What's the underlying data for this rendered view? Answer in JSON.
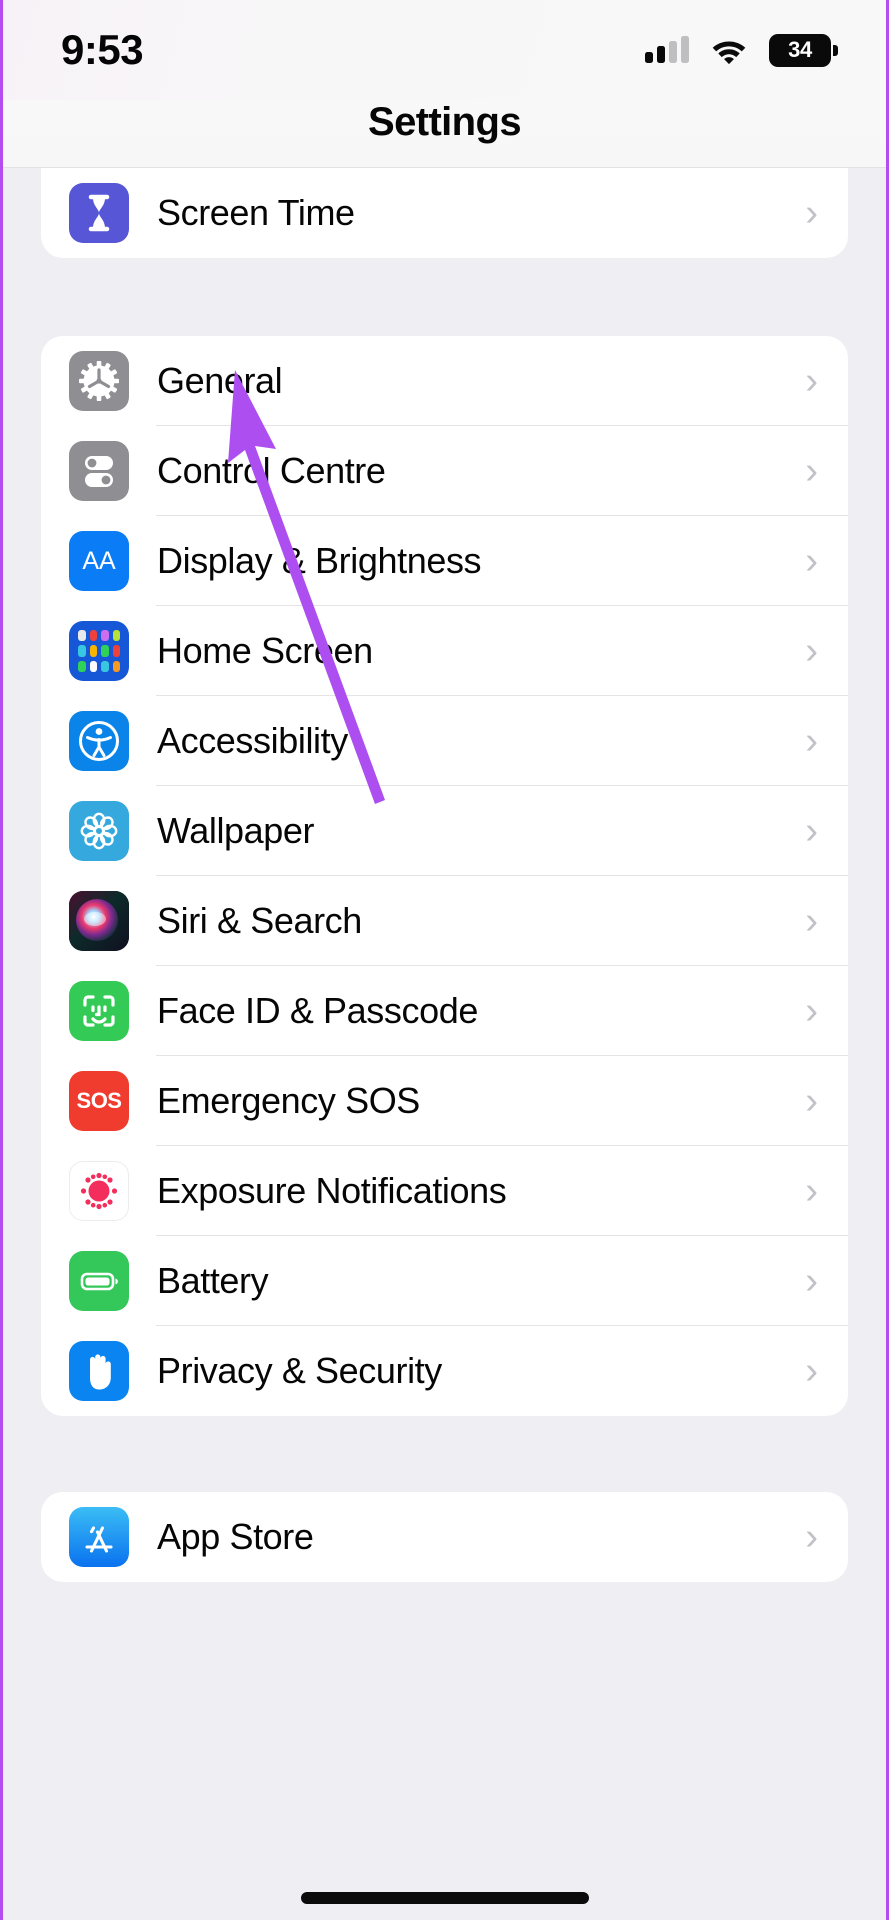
{
  "status_bar": {
    "time": "9:53",
    "cellular_icon": "cellular-signal-icon",
    "cellular_bars_filled": 2,
    "cellular_bars_total": 4,
    "wifi_icon": "wifi-icon",
    "battery_icon": "battery-icon",
    "battery_percent": "34"
  },
  "nav": {
    "title": "Settings"
  },
  "groups": [
    {
      "name": "screen-time-group",
      "rows": [
        {
          "label": "Screen Time",
          "icon": "hourglass-icon",
          "color": "#5656d6",
          "chevron": "›"
        }
      ]
    },
    {
      "name": "system-group",
      "rows": [
        {
          "label": "General",
          "icon": "gear-icon",
          "color": "#8e8e93",
          "chevron": "›"
        },
        {
          "label": "Control Centre",
          "icon": "toggles-icon",
          "color": "#8e8e93",
          "chevron": "›"
        },
        {
          "label": "Display & Brightness",
          "icon": "text-size-icon",
          "color": "#0a7cf5",
          "chevron": "›"
        },
        {
          "label": "Home Screen",
          "icon": "app-grid-icon",
          "color": "#1657d8",
          "chevron": "›"
        },
        {
          "label": "Accessibility",
          "icon": "accessibility-person-icon",
          "color": "#0a84e8",
          "chevron": "›"
        },
        {
          "label": "Wallpaper",
          "icon": "flower-icon",
          "color": "#35a9dd",
          "chevron": "›"
        },
        {
          "label": "Siri & Search",
          "icon": "siri-orb-icon",
          "color": "#1b1b24",
          "chevron": "›"
        },
        {
          "label": "Face ID & Passcode",
          "icon": "face-id-icon",
          "color": "#33cb56",
          "chevron": "›"
        },
        {
          "label": "Emergency SOS",
          "icon": "sos-icon",
          "color": "#f03c2f",
          "chevron": "›"
        },
        {
          "label": "Exposure Notifications",
          "icon": "exposure-notifications-icon",
          "color": "#ffffff",
          "chevron": "›"
        },
        {
          "label": "Battery",
          "icon": "battery-full-icon",
          "color": "#34c759",
          "chevron": "›"
        },
        {
          "label": "Privacy & Security",
          "icon": "hand-raised-icon",
          "color": "#0a84f0",
          "chevron": "›"
        }
      ]
    },
    {
      "name": "store-group",
      "rows": [
        {
          "label": "App Store",
          "icon": "app-store-icon",
          "color": "#0f8ef0",
          "chevron": "›"
        }
      ]
    }
  ],
  "annotation": {
    "pointer_icon": "arrow-pointer-annotation",
    "color": "#ac4ef0",
    "points_at": "General"
  },
  "sos_text": "SOS",
  "aa_text": "AA"
}
